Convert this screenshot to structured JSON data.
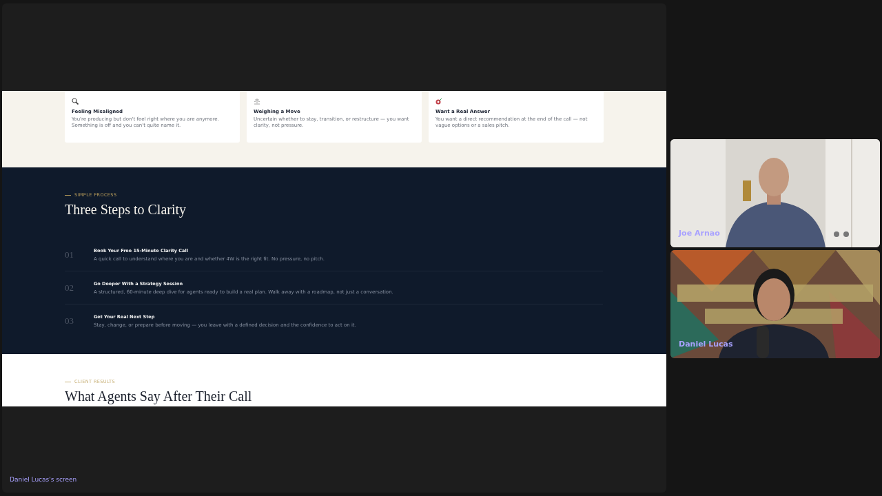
{
  "screen_share": {
    "owner_label": "Daniel Lucas's screen",
    "intro_cards": [
      {
        "title": "Feeling Misaligned",
        "text": "You're producing but don't feel right where you are anymore. Something is off and you can't quite name it."
      },
      {
        "title": "Weighing a Move",
        "text": "Uncertain whether to stay, transition, or restructure — you want clarity, not pressure."
      },
      {
        "title": "Want a Real Answer",
        "text": "You want a direct recommendation at the end of the call — not vague options or a sales pitch."
      }
    ],
    "process": {
      "eyebrow": "SIMPLE PROCESS",
      "heading": "Three Steps to Clarity",
      "steps": [
        {
          "number": "01",
          "title": "Book Your Free 15-Minute Clarity Call",
          "text": "A quick call to understand where you are and whether 4W is the right fit. No pressure, no pitch."
        },
        {
          "number": "02",
          "title": "Go Deeper With a Strategy Session",
          "text": "A structured, 60-minute deep dive for agents ready to build a real plan. Walk away with a roadmap, not just a conversation."
        },
        {
          "number": "03",
          "title": "Get Your Real Next Step",
          "text": "Stay, change, or prepare before moving — you leave with a defined decision and the confidence to act on it."
        }
      ]
    },
    "results": {
      "eyebrow": "CLIENT RESULTS",
      "heading": "What Agents Say After Their Call"
    }
  },
  "participants": [
    {
      "name": "Joe Arnao"
    },
    {
      "name": "Daniel Lucas"
    }
  ]
}
